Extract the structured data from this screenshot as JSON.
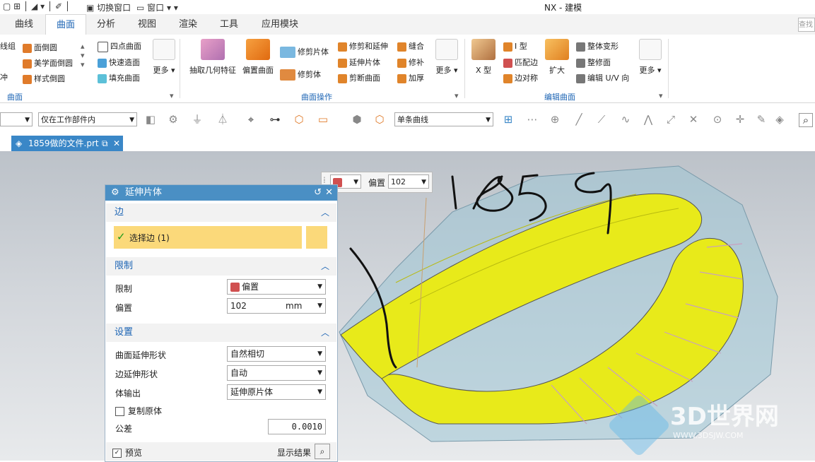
{
  "titlebar": {
    "switch_window": "切换窗口",
    "window_menu": "窗口",
    "app_title": "NX - 建模"
  },
  "tabs": [
    "曲线",
    "曲面",
    "分析",
    "视图",
    "渲染",
    "工具",
    "应用模块"
  ],
  "search_placeholder": "查找",
  "ribbon": {
    "left_cut_1": "线组",
    "left_cut_2": "冲",
    "col1": [
      "面倒圆",
      "美学面倒圆",
      "样式倒圆"
    ],
    "col2": [
      "四点曲面",
      "快速造面",
      "填充曲面"
    ],
    "more": "更多",
    "group_surface": "曲面",
    "big1": "抽取几何特征",
    "big2": "偏置曲面",
    "col3": [
      "修剪片体",
      "修剪体"
    ],
    "col4": [
      "修剪和延伸",
      "延伸片体",
      "剪断曲面"
    ],
    "col5": [
      "缝合",
      "修补",
      "加厚"
    ],
    "group_surface_ops": "曲面操作",
    "big3": "X 型",
    "col6": [
      "I 型",
      "匹配边",
      "边对称"
    ],
    "big4": "扩大",
    "col7": [
      "整体变形",
      "整修面",
      "编辑 U/V 向"
    ],
    "group_edit_surface": "编辑曲面"
  },
  "toolbar": {
    "filter_scope": "仅在工作部件内",
    "curve_rule": "单条曲线"
  },
  "file_tab": "1859做的文件.prt",
  "float_bar": {
    "label": "偏置",
    "value": "102"
  },
  "dialog": {
    "title": "延伸片体",
    "edge_section": "边",
    "select_edge": "选择边 (1)",
    "limit_section": "限制",
    "limit_label": "限制",
    "limit_value": "偏置",
    "offset_label": "偏置",
    "offset_value": "102",
    "offset_unit": "mm",
    "settings_section": "设置",
    "surface_ext_label": "曲面延伸形状",
    "surface_ext_value": "自然相切",
    "edge_ext_label": "边延伸形状",
    "edge_ext_value": "自动",
    "body_output_label": "体输出",
    "body_output_value": "延伸原片体",
    "copy_original": "复制原体",
    "tolerance_label": "公差",
    "tolerance_value": "0.0010",
    "preview": "预览",
    "show_result": "显示结果"
  },
  "annotation_text": "1859",
  "watermark": {
    "name": "3D世界网",
    "url": "WWW.3DSJW.COM"
  },
  "colors": {
    "accent": "#1c64b4",
    "dialog_header": "#4a8fc4",
    "selected_row": "#fbd97a",
    "surface_yellow": "#e8ea1a",
    "body_blue": "#9fc6d6"
  }
}
